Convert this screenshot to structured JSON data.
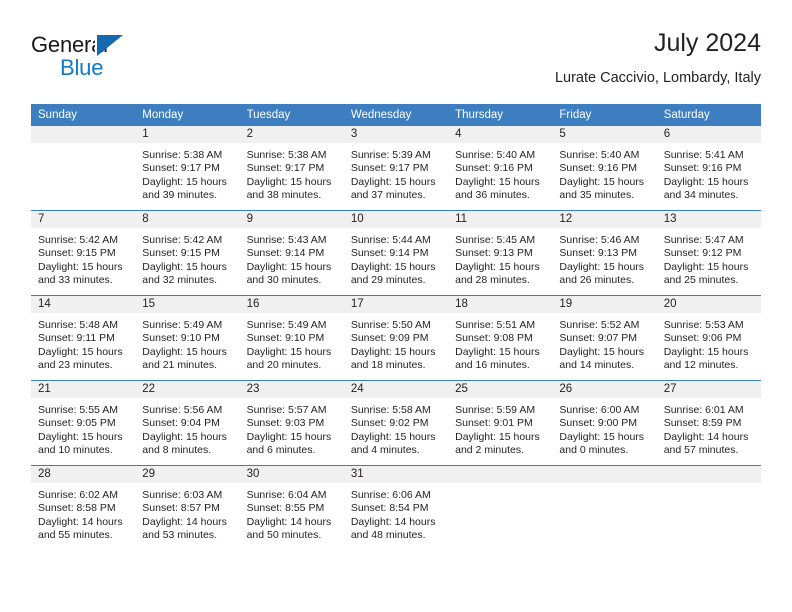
{
  "brand": {
    "name_part1": "General",
    "name_part2": "Blue",
    "logo_icon": "triangle-logo-icon",
    "accent_color": "#1279c6",
    "triangle_color": "#1668b0"
  },
  "header": {
    "title": "July 2024",
    "subtitle": "Lurate Caccivio, Lombardy, Italy"
  },
  "calendar": {
    "header_bg_color": "#3c7ebf",
    "daynum_bg_color": "#f0f0f0",
    "weekday_headers": [
      "Sunday",
      "Monday",
      "Tuesday",
      "Wednesday",
      "Thursday",
      "Friday",
      "Saturday"
    ],
    "weeks": [
      [
        {
          "day": "",
          "sunrise": "",
          "sunset": "",
          "daylight_line1": "",
          "daylight_line2": "",
          "empty": true
        },
        {
          "day": "1",
          "sunrise": "Sunrise: 5:38 AM",
          "sunset": "Sunset: 9:17 PM",
          "daylight_line1": "Daylight: 15 hours",
          "daylight_line2": "and 39 minutes."
        },
        {
          "day": "2",
          "sunrise": "Sunrise: 5:38 AM",
          "sunset": "Sunset: 9:17 PM",
          "daylight_line1": "Daylight: 15 hours",
          "daylight_line2": "and 38 minutes."
        },
        {
          "day": "3",
          "sunrise": "Sunrise: 5:39 AM",
          "sunset": "Sunset: 9:17 PM",
          "daylight_line1": "Daylight: 15 hours",
          "daylight_line2": "and 37 minutes."
        },
        {
          "day": "4",
          "sunrise": "Sunrise: 5:40 AM",
          "sunset": "Sunset: 9:16 PM",
          "daylight_line1": "Daylight: 15 hours",
          "daylight_line2": "and 36 minutes."
        },
        {
          "day": "5",
          "sunrise": "Sunrise: 5:40 AM",
          "sunset": "Sunset: 9:16 PM",
          "daylight_line1": "Daylight: 15 hours",
          "daylight_line2": "and 35 minutes."
        },
        {
          "day": "6",
          "sunrise": "Sunrise: 5:41 AM",
          "sunset": "Sunset: 9:16 PM",
          "daylight_line1": "Daylight: 15 hours",
          "daylight_line2": "and 34 minutes."
        }
      ],
      [
        {
          "day": "7",
          "sunrise": "Sunrise: 5:42 AM",
          "sunset": "Sunset: 9:15 PM",
          "daylight_line1": "Daylight: 15 hours",
          "daylight_line2": "and 33 minutes."
        },
        {
          "day": "8",
          "sunrise": "Sunrise: 5:42 AM",
          "sunset": "Sunset: 9:15 PM",
          "daylight_line1": "Daylight: 15 hours",
          "daylight_line2": "and 32 minutes."
        },
        {
          "day": "9",
          "sunrise": "Sunrise: 5:43 AM",
          "sunset": "Sunset: 9:14 PM",
          "daylight_line1": "Daylight: 15 hours",
          "daylight_line2": "and 30 minutes."
        },
        {
          "day": "10",
          "sunrise": "Sunrise: 5:44 AM",
          "sunset": "Sunset: 9:14 PM",
          "daylight_line1": "Daylight: 15 hours",
          "daylight_line2": "and 29 minutes."
        },
        {
          "day": "11",
          "sunrise": "Sunrise: 5:45 AM",
          "sunset": "Sunset: 9:13 PM",
          "daylight_line1": "Daylight: 15 hours",
          "daylight_line2": "and 28 minutes."
        },
        {
          "day": "12",
          "sunrise": "Sunrise: 5:46 AM",
          "sunset": "Sunset: 9:13 PM",
          "daylight_line1": "Daylight: 15 hours",
          "daylight_line2": "and 26 minutes."
        },
        {
          "day": "13",
          "sunrise": "Sunrise: 5:47 AM",
          "sunset": "Sunset: 9:12 PM",
          "daylight_line1": "Daylight: 15 hours",
          "daylight_line2": "and 25 minutes."
        }
      ],
      [
        {
          "day": "14",
          "sunrise": "Sunrise: 5:48 AM",
          "sunset": "Sunset: 9:11 PM",
          "daylight_line1": "Daylight: 15 hours",
          "daylight_line2": "and 23 minutes."
        },
        {
          "day": "15",
          "sunrise": "Sunrise: 5:49 AM",
          "sunset": "Sunset: 9:10 PM",
          "daylight_line1": "Daylight: 15 hours",
          "daylight_line2": "and 21 minutes."
        },
        {
          "day": "16",
          "sunrise": "Sunrise: 5:49 AM",
          "sunset": "Sunset: 9:10 PM",
          "daylight_line1": "Daylight: 15 hours",
          "daylight_line2": "and 20 minutes."
        },
        {
          "day": "17",
          "sunrise": "Sunrise: 5:50 AM",
          "sunset": "Sunset: 9:09 PM",
          "daylight_line1": "Daylight: 15 hours",
          "daylight_line2": "and 18 minutes."
        },
        {
          "day": "18",
          "sunrise": "Sunrise: 5:51 AM",
          "sunset": "Sunset: 9:08 PM",
          "daylight_line1": "Daylight: 15 hours",
          "daylight_line2": "and 16 minutes."
        },
        {
          "day": "19",
          "sunrise": "Sunrise: 5:52 AM",
          "sunset": "Sunset: 9:07 PM",
          "daylight_line1": "Daylight: 15 hours",
          "daylight_line2": "and 14 minutes."
        },
        {
          "day": "20",
          "sunrise": "Sunrise: 5:53 AM",
          "sunset": "Sunset: 9:06 PM",
          "daylight_line1": "Daylight: 15 hours",
          "daylight_line2": "and 12 minutes."
        }
      ],
      [
        {
          "day": "21",
          "sunrise": "Sunrise: 5:55 AM",
          "sunset": "Sunset: 9:05 PM",
          "daylight_line1": "Daylight: 15 hours",
          "daylight_line2": "and 10 minutes."
        },
        {
          "day": "22",
          "sunrise": "Sunrise: 5:56 AM",
          "sunset": "Sunset: 9:04 PM",
          "daylight_line1": "Daylight: 15 hours",
          "daylight_line2": "and 8 minutes."
        },
        {
          "day": "23",
          "sunrise": "Sunrise: 5:57 AM",
          "sunset": "Sunset: 9:03 PM",
          "daylight_line1": "Daylight: 15 hours",
          "daylight_line2": "and 6 minutes."
        },
        {
          "day": "24",
          "sunrise": "Sunrise: 5:58 AM",
          "sunset": "Sunset: 9:02 PM",
          "daylight_line1": "Daylight: 15 hours",
          "daylight_line2": "and 4 minutes."
        },
        {
          "day": "25",
          "sunrise": "Sunrise: 5:59 AM",
          "sunset": "Sunset: 9:01 PM",
          "daylight_line1": "Daylight: 15 hours",
          "daylight_line2": "and 2 minutes."
        },
        {
          "day": "26",
          "sunrise": "Sunrise: 6:00 AM",
          "sunset": "Sunset: 9:00 PM",
          "daylight_line1": "Daylight: 15 hours",
          "daylight_line2": "and 0 minutes."
        },
        {
          "day": "27",
          "sunrise": "Sunrise: 6:01 AM",
          "sunset": "Sunset: 8:59 PM",
          "daylight_line1": "Daylight: 14 hours",
          "daylight_line2": "and 57 minutes."
        }
      ],
      [
        {
          "day": "28",
          "sunrise": "Sunrise: 6:02 AM",
          "sunset": "Sunset: 8:58 PM",
          "daylight_line1": "Daylight: 14 hours",
          "daylight_line2": "and 55 minutes."
        },
        {
          "day": "29",
          "sunrise": "Sunrise: 6:03 AM",
          "sunset": "Sunset: 8:57 PM",
          "daylight_line1": "Daylight: 14 hours",
          "daylight_line2": "and 53 minutes."
        },
        {
          "day": "30",
          "sunrise": "Sunrise: 6:04 AM",
          "sunset": "Sunset: 8:55 PM",
          "daylight_line1": "Daylight: 14 hours",
          "daylight_line2": "and 50 minutes."
        },
        {
          "day": "31",
          "sunrise": "Sunrise: 6:06 AM",
          "sunset": "Sunset: 8:54 PM",
          "daylight_line1": "Daylight: 14 hours",
          "daylight_line2": "and 48 minutes."
        },
        {
          "day": "",
          "sunrise": "",
          "sunset": "",
          "daylight_line1": "",
          "daylight_line2": "",
          "empty": true
        },
        {
          "day": "",
          "sunrise": "",
          "sunset": "",
          "daylight_line1": "",
          "daylight_line2": "",
          "empty": true
        },
        {
          "day": "",
          "sunrise": "",
          "sunset": "",
          "daylight_line1": "",
          "daylight_line2": "",
          "empty": true
        }
      ]
    ]
  }
}
